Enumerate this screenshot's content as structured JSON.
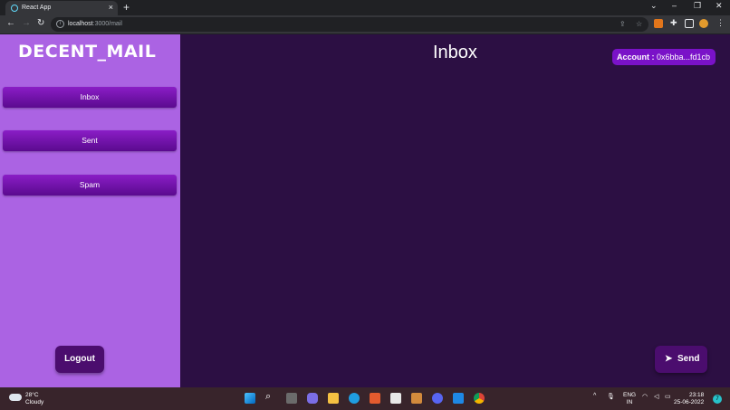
{
  "browser": {
    "tab_title": "React App",
    "new_tab": "+",
    "url_host": "localhost",
    "url_path": ":3000/mail",
    "window_controls": [
      "⌄",
      "–",
      "❐",
      "✕"
    ]
  },
  "app": {
    "logo": "DECENT_MAIL",
    "nav": [
      {
        "label": "Inbox"
      },
      {
        "label": "Sent"
      },
      {
        "label": "Spam"
      }
    ],
    "logout_label": "Logout",
    "page_title": "Inbox",
    "account_label": "Account :",
    "account_value": " 0x6bba...fd1cb",
    "send_label": "Send",
    "colors": {
      "sidebar": "#ab63e3",
      "main_bg": "#2c0f43",
      "button": "#7a12c8",
      "dark_button": "#4b0d6e"
    }
  },
  "taskbar": {
    "weather_temp": "28°C",
    "weather_desc": "Cloudy",
    "lang_top": "ENG",
    "lang_bottom": "IN",
    "time": "23:18",
    "date": "25-06-2022",
    "notification_count": "7"
  }
}
